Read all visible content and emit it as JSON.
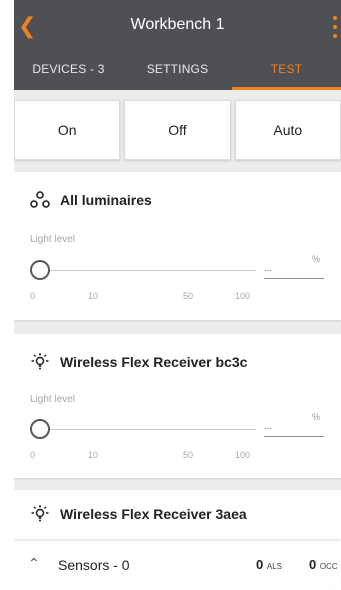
{
  "header": {
    "title": "Workbench 1"
  },
  "tabs": [
    {
      "label": "DEVICES - 3"
    },
    {
      "label": "SETTINGS"
    },
    {
      "label": "TEST"
    }
  ],
  "modes": [
    {
      "label": "On"
    },
    {
      "label": "Off"
    },
    {
      "label": "Auto"
    }
  ],
  "cards": [
    {
      "title": "All luminaires",
      "icon": "luminaires-group-icon",
      "level_label": "Light level",
      "level_value": 0,
      "percent_value": "...",
      "percent_unit": "%",
      "ticks": [
        "0",
        "10",
        "50",
        "100"
      ]
    },
    {
      "title": "Wireless Flex Receiver bc3c",
      "icon": "bulb-icon",
      "level_label": "Light level",
      "level_value": 0,
      "percent_value": "...",
      "percent_unit": "%",
      "ticks": [
        "0",
        "10",
        "50",
        "100"
      ]
    },
    {
      "title": "Wireless Flex Receiver 3aea",
      "icon": "bulb-icon"
    }
  ],
  "footer": {
    "sensors_label": "Sensors - 0",
    "als_count": "0",
    "als_label": "ALS",
    "occ_count": "0",
    "occ_label": "OCC"
  },
  "colors": {
    "accent": "#f0821f",
    "header": "#4e5055",
    "background": "#ececec"
  }
}
